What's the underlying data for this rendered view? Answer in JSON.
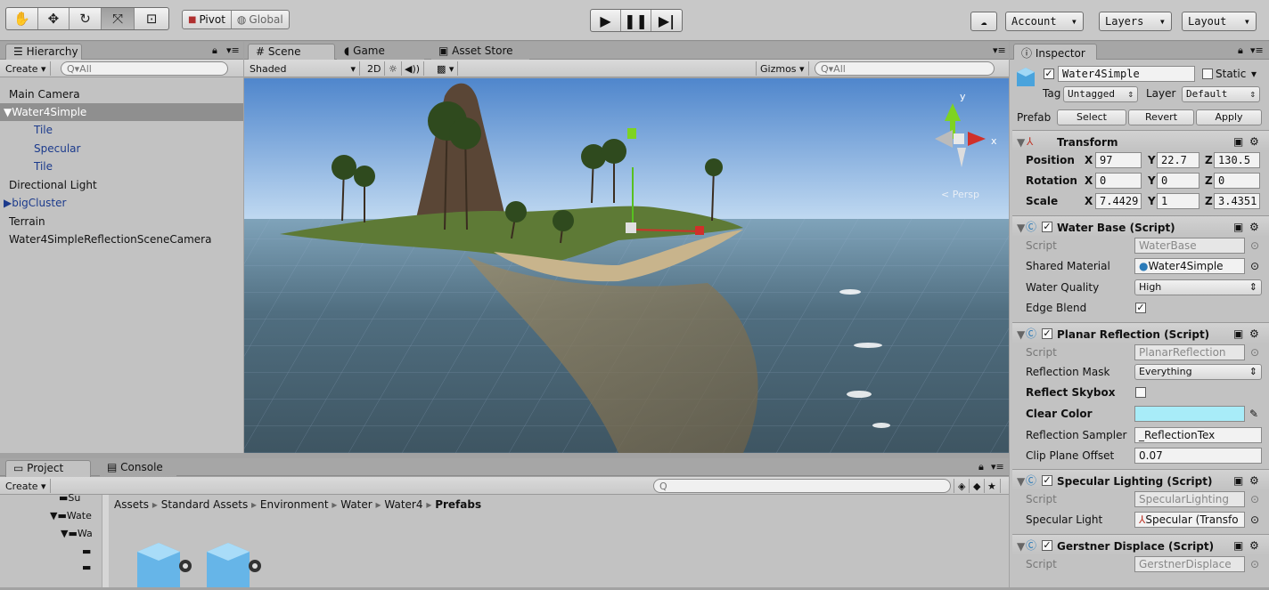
{
  "toolbar": {
    "pivot_label": "Pivot",
    "global_label": "Global",
    "account_label": "Account",
    "layers_label": "Layers",
    "layout_label": "Layout"
  },
  "hierarchy": {
    "tab_label": "Hierarchy",
    "create_label": "Create",
    "search_placeholder": "Q▾All",
    "items": [
      {
        "label": "Main Camera"
      },
      {
        "label": "Water4Simple"
      },
      {
        "label": "Tile"
      },
      {
        "label": "Specular"
      },
      {
        "label": "Tile"
      },
      {
        "label": "Directional Light"
      },
      {
        "label": "bigCluster"
      },
      {
        "label": "Terrain"
      },
      {
        "label": "Water4SimpleReflectionSceneCamera"
      }
    ]
  },
  "scene": {
    "tabs": [
      {
        "label": "Scene"
      },
      {
        "label": "Game"
      },
      {
        "label": "Asset Store"
      }
    ],
    "shading_mode": "Shaded",
    "mode_2d": "2D",
    "gizmos_label": "Gizmos",
    "search_placeholder": "Q▾All",
    "persp_label": "< Persp",
    "axis_y": "y",
    "axis_x": "x"
  },
  "project": {
    "tabs": [
      {
        "label": "Project"
      },
      {
        "label": "Console"
      }
    ],
    "create_label": "Create",
    "search_placeholder": "Q",
    "breadcrumb": [
      "Assets",
      "Standard Assets",
      "Environment",
      "Water",
      "Water4",
      "Prefabs"
    ],
    "tree_items": [
      {
        "label": "Su"
      },
      {
        "label": "Wate"
      },
      {
        "label": "Wa"
      }
    ]
  },
  "inspector": {
    "tab_label": "Inspector",
    "object_name": "Water4Simple",
    "static_label": "Static",
    "tag_label": "Tag",
    "tag_value": "Untagged",
    "layer_label": "Layer",
    "layer_value": "Default",
    "prefab_label": "Prefab",
    "prefab_select": "Select",
    "prefab_revert": "Revert",
    "prefab_apply": "Apply",
    "transform": {
      "title": "Transform",
      "position_label": "Position",
      "rotation_label": "Rotation",
      "scale_label": "Scale",
      "x_label": "X",
      "y_label": "Y",
      "z_label": "Z",
      "position": [
        "97",
        "22.7",
        "130.5"
      ],
      "rotation": [
        "0",
        "0",
        "0"
      ],
      "scale": [
        "7.4429",
        "1",
        "3.4351"
      ]
    },
    "water_base": {
      "title": "Water Base (Script)",
      "script_label": "Script",
      "script_value": "WaterBase",
      "shared_material_label": "Shared Material",
      "shared_material_value": "Water4Simple",
      "water_quality_label": "Water Quality",
      "water_quality_value": "High",
      "edge_blend_label": "Edge Blend",
      "edge_blend_checked": true
    },
    "planar_reflection": {
      "title": "Planar Reflection (Script)",
      "script_label": "Script",
      "script_value": "PlanarReflection",
      "reflection_mask_label": "Reflection Mask",
      "reflection_mask_value": "Everything",
      "reflect_skybox_label": "Reflect Skybox",
      "reflect_skybox_checked": false,
      "clear_color_label": "Clear Color",
      "clear_color_value": "#a8ecf8",
      "reflection_sampler_label": "Reflection Sampler",
      "reflection_sampler_value": "_ReflectionTex",
      "clip_plane_offset_label": "Clip Plane Offset",
      "clip_plane_offset_value": "0.07"
    },
    "specular_lighting": {
      "title": "Specular Lighting (Script)",
      "script_label": "Script",
      "script_value": "SpecularLighting",
      "specular_light_label": "Specular Light",
      "specular_light_value": "Specular (Transfo"
    },
    "gerstner": {
      "title": "Gerstner Displace (Script)",
      "script_label": "Script",
      "script_value": "GerstnerDisplace"
    }
  },
  "colors": {
    "selection": "#8a8a8a",
    "child_text": "#1b3a8c",
    "clear_color": "#a8ecf8"
  }
}
